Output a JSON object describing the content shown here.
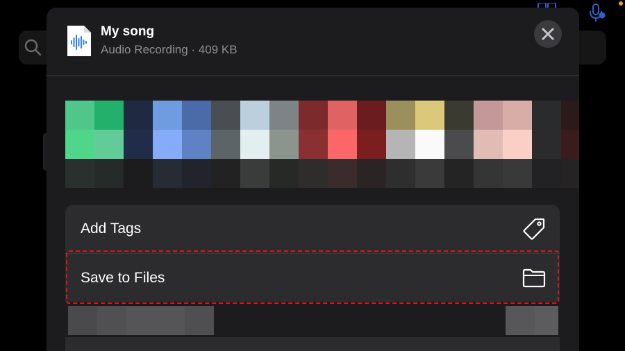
{
  "file": {
    "title": "My song",
    "subtitle": "Audio Recording · 409 KB",
    "icon": "audio-waveform-file-icon"
  },
  "actions": [
    {
      "label": "Add Tags",
      "icon": "tag-icon"
    },
    {
      "label": "Save to Files",
      "icon": "folder-icon"
    }
  ],
  "colors": {
    "sheet_bg": "#1c1c1e",
    "group_bg": "#2c2c2e",
    "text_primary": "#ffffff",
    "text_secondary": "#8e8e93",
    "highlight": "#e0131a",
    "file_icon_accent": "#2f7df6"
  }
}
